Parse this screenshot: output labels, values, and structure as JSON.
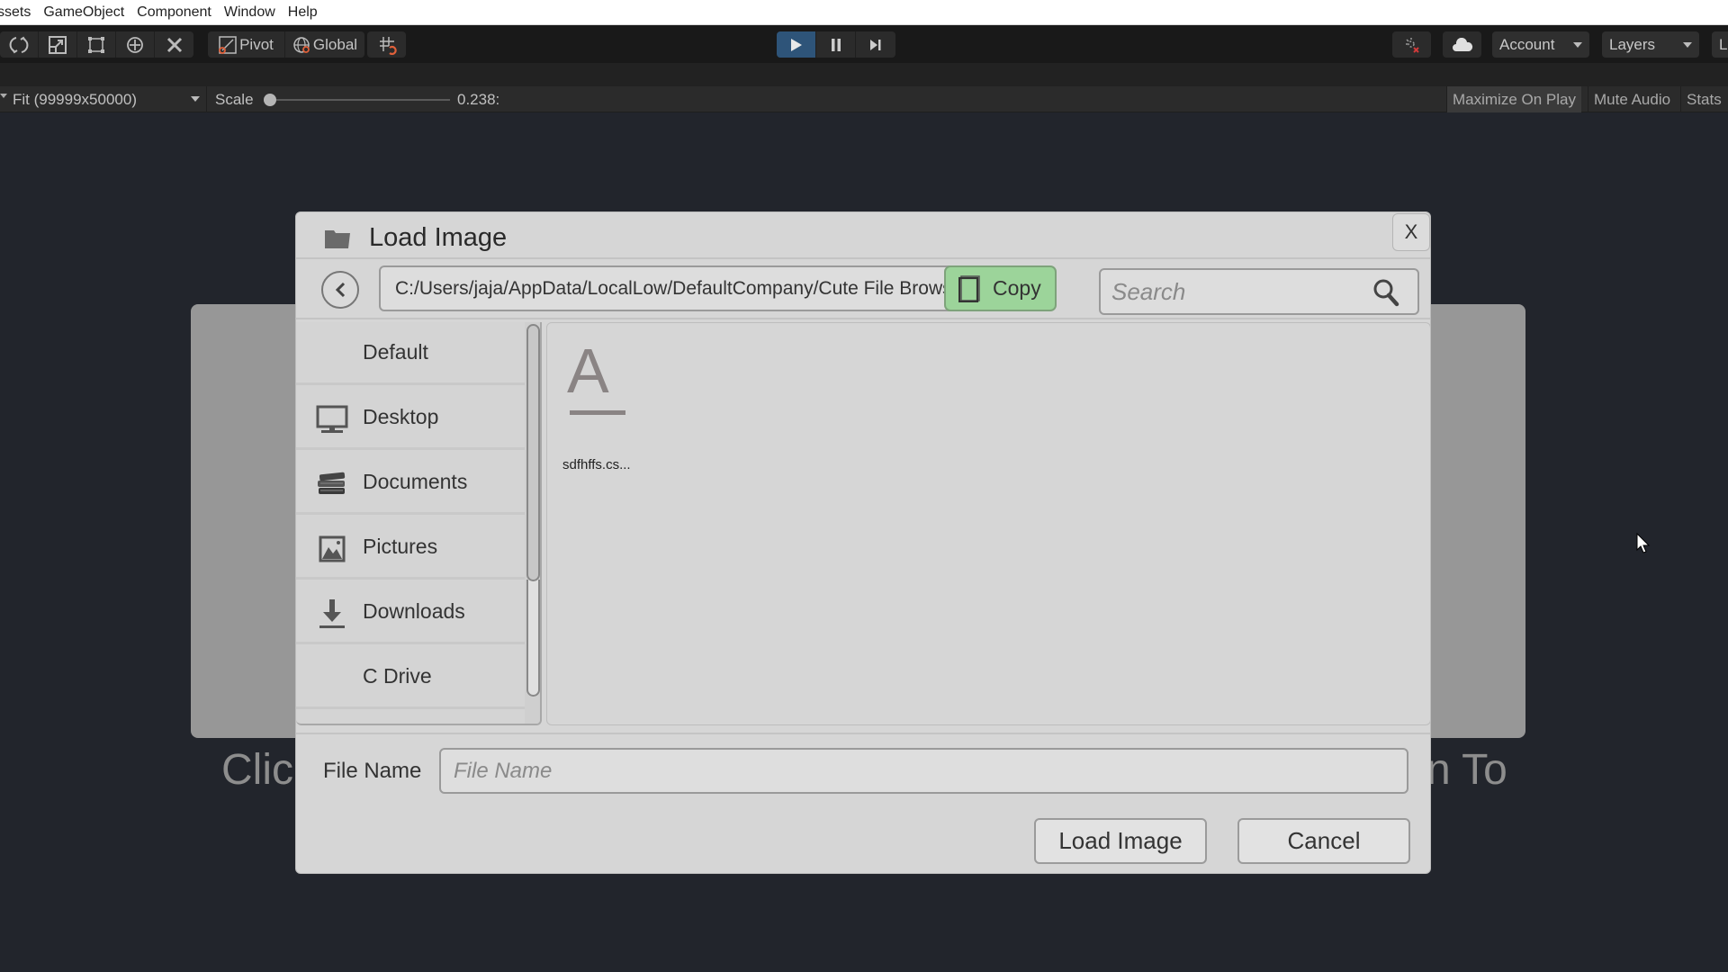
{
  "menubar": {
    "items": [
      "ssets",
      "GameObject",
      "Component",
      "Window",
      "Help"
    ]
  },
  "toolbar": {
    "tools": [
      "rotate-tool",
      "scale-tool",
      "rect-tool",
      "transform-tool",
      "custom-tool"
    ],
    "pivot_label": "Pivot",
    "global_label": "Global",
    "account_label": "Account",
    "layers_label": "Layers",
    "layout_label": "L",
    "play_active": true,
    "colors": {
      "play_active": "#2e5479",
      "accent_orange": "#e0603a"
    }
  },
  "gameview": {
    "resolution": "Fit (99999x50000)",
    "scale_label": "Scale",
    "scale_value": "0.238:",
    "scale_fraction": 0.0,
    "toggles": [
      "Maximize On Play",
      "Mute Audio",
      "Stats"
    ]
  },
  "background": {
    "left_text": "Clic",
    "right_text": "n To"
  },
  "dialog": {
    "title": "Load Image",
    "close_label": "X",
    "path": "C:/Users/jaja/AppData/LocalLow/DefaultCompany/Cute File Browser",
    "copy_label": "Copy",
    "search_placeholder": "Search",
    "search_value": "",
    "sidebar": [
      {
        "label": "Default",
        "icon": ""
      },
      {
        "label": "Desktop",
        "icon": "monitor-icon"
      },
      {
        "label": "Documents",
        "icon": "books-icon"
      },
      {
        "label": "Pictures",
        "icon": "picture-icon"
      },
      {
        "label": "Downloads",
        "icon": "download-icon"
      },
      {
        "label": "C Drive",
        "icon": ""
      }
    ],
    "files": [
      {
        "name": "sdfhffs.cs...",
        "glyph": "A",
        "icon": "text-file-icon"
      }
    ],
    "filename_label": "File Name",
    "filename_placeholder": "File Name",
    "filename_value": "",
    "load_label": "Load Image",
    "cancel_label": "Cancel",
    "colors": {
      "copy_button": "#9cd49a",
      "dialog_bg": "#d6d6d6"
    }
  }
}
